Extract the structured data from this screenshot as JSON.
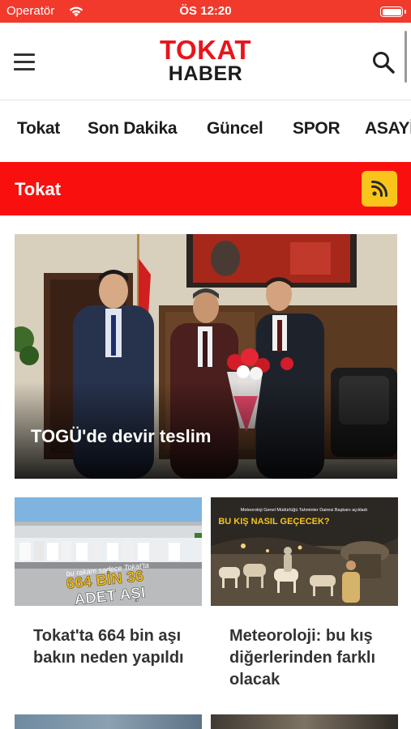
{
  "status_bar": {
    "carrier": "Operatör",
    "time": "ÖS 12:20"
  },
  "header": {
    "logo_line1": "TOKAT",
    "logo_line2": "HABER",
    "icons": [
      "menu-icon",
      "search-icon"
    ]
  },
  "categories": [
    "Tokat",
    "Son Dakika",
    "Güncel",
    "SPOR",
    "ASAYİŞ"
  ],
  "section": {
    "title": "Tokat",
    "icon": "rss-icon"
  },
  "hero": {
    "title": "TOGÜ'de devir teslim"
  },
  "cards": [
    {
      "title": "Tokat'ta 664 bin aşı bakın neden yapıldı",
      "thumb_caption_small": "bu rakam sadece Tokat'ta",
      "thumb_caption_big1": "664 BİN 36",
      "thumb_caption_big2": "ADET AŞI"
    },
    {
      "title": "Meteoroloji: bu kış diğerlerinden farklı olacak",
      "thumb_caption_small": "Meteoroloji Genel Müdürlüğü Tahminler Dairesi Başkanı açıkladı",
      "thumb_caption_big": "BU KIŞ NASIL GEÇECEK?"
    }
  ],
  "colors": {
    "status_bar": "#f23a2c",
    "brand_red": "#e8151b",
    "section_red": "#fa0f0f",
    "rss_yellow": "#f9c51a"
  }
}
